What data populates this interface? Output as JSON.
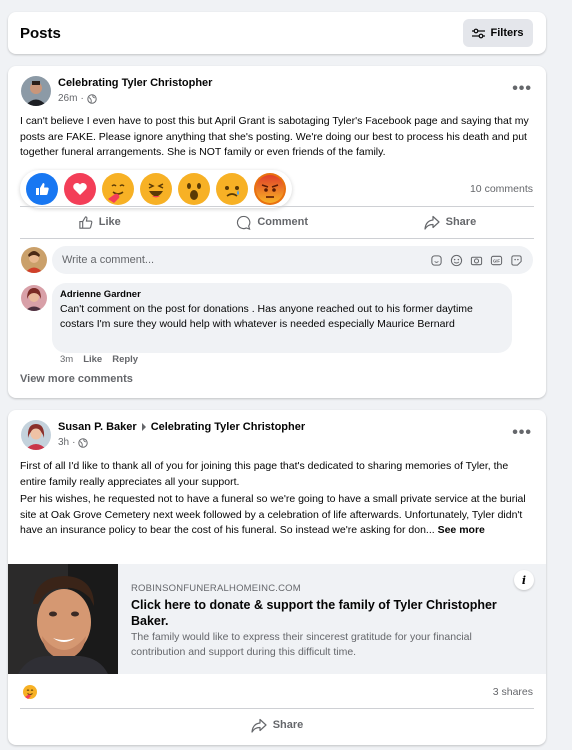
{
  "header": {
    "title": "Posts",
    "filters_label": "Filters"
  },
  "post1": {
    "group": "Celebrating Tyler Christopher",
    "time": "26m",
    "text": "I can't believe I even have to post this but April Grant is sabotaging Tyler's Facebook page and saying that my posts are FAKE. Please ignore anything that she's posting. We're doing our best to process his death and put together funeral arrangements. She is NOT family or even friends of the family.",
    "reactions": [
      "like",
      "love",
      "care",
      "haha",
      "wow",
      "sad",
      "angry"
    ],
    "comments_count": "10 comments",
    "actions": {
      "like": "Like",
      "comment": "Comment",
      "share": "Share"
    },
    "comment_placeholder": "Write a comment...",
    "comment": {
      "author": "Adrienne Gardner",
      "text": "Can't comment on the post for donations . Has anyone reached out to his former daytime costars I'm sure they would help with whatever is needed especially Maurice Bernard",
      "time": "3m",
      "like": "Like",
      "reply": "Reply"
    },
    "view_more": "View more comments"
  },
  "post2": {
    "author": "Susan P. Baker",
    "group": "Celebrating Tyler Christopher",
    "time": "3h",
    "paragraph1": "First of all I'd like to thank all of you for joining this page that's dedicated to sharing memories of Tyler, the entire family really appreciates all your support.",
    "paragraph2": "Per his wishes, he requested not to have a funeral so we're going to have a small private service at the burial site at Oak Grove Cemetery next week followed by a celebration of life afterwards. Unfortunately, Tyler didn't have an insurance policy to bear the cost of his funeral. So instead we're asking for don...",
    "see_more": "See more",
    "link": {
      "domain": "ROBINSONFUNERALHOMEINC.COM",
      "title": "Click here to donate & support the family of Tyler Christopher Baker.",
      "description": "The family would like to express their sincerest gratitude for your financial contribution and support during this difficult time."
    },
    "shares": "3 shares",
    "share_label": "Share"
  }
}
